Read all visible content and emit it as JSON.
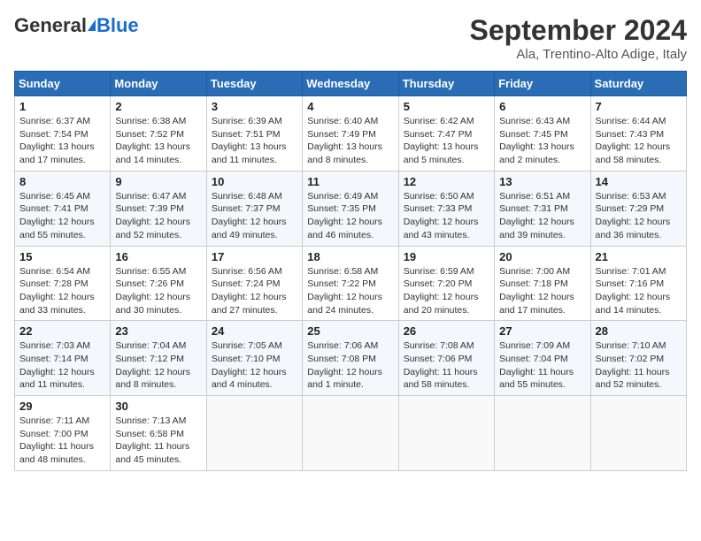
{
  "header": {
    "logo_general": "General",
    "logo_blue": "Blue",
    "month_title": "September 2024",
    "subtitle": "Ala, Trentino-Alto Adige, Italy"
  },
  "columns": [
    "Sunday",
    "Monday",
    "Tuesday",
    "Wednesday",
    "Thursday",
    "Friday",
    "Saturday"
  ],
  "weeks": [
    [
      {
        "day": "1",
        "sunrise": "Sunrise: 6:37 AM",
        "sunset": "Sunset: 7:54 PM",
        "daylight": "Daylight: 13 hours and 17 minutes."
      },
      {
        "day": "2",
        "sunrise": "Sunrise: 6:38 AM",
        "sunset": "Sunset: 7:52 PM",
        "daylight": "Daylight: 13 hours and 14 minutes."
      },
      {
        "day": "3",
        "sunrise": "Sunrise: 6:39 AM",
        "sunset": "Sunset: 7:51 PM",
        "daylight": "Daylight: 13 hours and 11 minutes."
      },
      {
        "day": "4",
        "sunrise": "Sunrise: 6:40 AM",
        "sunset": "Sunset: 7:49 PM",
        "daylight": "Daylight: 13 hours and 8 minutes."
      },
      {
        "day": "5",
        "sunrise": "Sunrise: 6:42 AM",
        "sunset": "Sunset: 7:47 PM",
        "daylight": "Daylight: 13 hours and 5 minutes."
      },
      {
        "day": "6",
        "sunrise": "Sunrise: 6:43 AM",
        "sunset": "Sunset: 7:45 PM",
        "daylight": "Daylight: 13 hours and 2 minutes."
      },
      {
        "day": "7",
        "sunrise": "Sunrise: 6:44 AM",
        "sunset": "Sunset: 7:43 PM",
        "daylight": "Daylight: 12 hours and 58 minutes."
      }
    ],
    [
      {
        "day": "8",
        "sunrise": "Sunrise: 6:45 AM",
        "sunset": "Sunset: 7:41 PM",
        "daylight": "Daylight: 12 hours and 55 minutes."
      },
      {
        "day": "9",
        "sunrise": "Sunrise: 6:47 AM",
        "sunset": "Sunset: 7:39 PM",
        "daylight": "Daylight: 12 hours and 52 minutes."
      },
      {
        "day": "10",
        "sunrise": "Sunrise: 6:48 AM",
        "sunset": "Sunset: 7:37 PM",
        "daylight": "Daylight: 12 hours and 49 minutes."
      },
      {
        "day": "11",
        "sunrise": "Sunrise: 6:49 AM",
        "sunset": "Sunset: 7:35 PM",
        "daylight": "Daylight: 12 hours and 46 minutes."
      },
      {
        "day": "12",
        "sunrise": "Sunrise: 6:50 AM",
        "sunset": "Sunset: 7:33 PM",
        "daylight": "Daylight: 12 hours and 43 minutes."
      },
      {
        "day": "13",
        "sunrise": "Sunrise: 6:51 AM",
        "sunset": "Sunset: 7:31 PM",
        "daylight": "Daylight: 12 hours and 39 minutes."
      },
      {
        "day": "14",
        "sunrise": "Sunrise: 6:53 AM",
        "sunset": "Sunset: 7:29 PM",
        "daylight": "Daylight: 12 hours and 36 minutes."
      }
    ],
    [
      {
        "day": "15",
        "sunrise": "Sunrise: 6:54 AM",
        "sunset": "Sunset: 7:28 PM",
        "daylight": "Daylight: 12 hours and 33 minutes."
      },
      {
        "day": "16",
        "sunrise": "Sunrise: 6:55 AM",
        "sunset": "Sunset: 7:26 PM",
        "daylight": "Daylight: 12 hours and 30 minutes."
      },
      {
        "day": "17",
        "sunrise": "Sunrise: 6:56 AM",
        "sunset": "Sunset: 7:24 PM",
        "daylight": "Daylight: 12 hours and 27 minutes."
      },
      {
        "day": "18",
        "sunrise": "Sunrise: 6:58 AM",
        "sunset": "Sunset: 7:22 PM",
        "daylight": "Daylight: 12 hours and 24 minutes."
      },
      {
        "day": "19",
        "sunrise": "Sunrise: 6:59 AM",
        "sunset": "Sunset: 7:20 PM",
        "daylight": "Daylight: 12 hours and 20 minutes."
      },
      {
        "day": "20",
        "sunrise": "Sunrise: 7:00 AM",
        "sunset": "Sunset: 7:18 PM",
        "daylight": "Daylight: 12 hours and 17 minutes."
      },
      {
        "day": "21",
        "sunrise": "Sunrise: 7:01 AM",
        "sunset": "Sunset: 7:16 PM",
        "daylight": "Daylight: 12 hours and 14 minutes."
      }
    ],
    [
      {
        "day": "22",
        "sunrise": "Sunrise: 7:03 AM",
        "sunset": "Sunset: 7:14 PM",
        "daylight": "Daylight: 12 hours and 11 minutes."
      },
      {
        "day": "23",
        "sunrise": "Sunrise: 7:04 AM",
        "sunset": "Sunset: 7:12 PM",
        "daylight": "Daylight: 12 hours and 8 minutes."
      },
      {
        "day": "24",
        "sunrise": "Sunrise: 7:05 AM",
        "sunset": "Sunset: 7:10 PM",
        "daylight": "Daylight: 12 hours and 4 minutes."
      },
      {
        "day": "25",
        "sunrise": "Sunrise: 7:06 AM",
        "sunset": "Sunset: 7:08 PM",
        "daylight": "Daylight: 12 hours and 1 minute."
      },
      {
        "day": "26",
        "sunrise": "Sunrise: 7:08 AM",
        "sunset": "Sunset: 7:06 PM",
        "daylight": "Daylight: 11 hours and 58 minutes."
      },
      {
        "day": "27",
        "sunrise": "Sunrise: 7:09 AM",
        "sunset": "Sunset: 7:04 PM",
        "daylight": "Daylight: 11 hours and 55 minutes."
      },
      {
        "day": "28",
        "sunrise": "Sunrise: 7:10 AM",
        "sunset": "Sunset: 7:02 PM",
        "daylight": "Daylight: 11 hours and 52 minutes."
      }
    ],
    [
      {
        "day": "29",
        "sunrise": "Sunrise: 7:11 AM",
        "sunset": "Sunset: 7:00 PM",
        "daylight": "Daylight: 11 hours and 48 minutes."
      },
      {
        "day": "30",
        "sunrise": "Sunrise: 7:13 AM",
        "sunset": "Sunset: 6:58 PM",
        "daylight": "Daylight: 11 hours and 45 minutes."
      },
      null,
      null,
      null,
      null,
      null
    ]
  ]
}
